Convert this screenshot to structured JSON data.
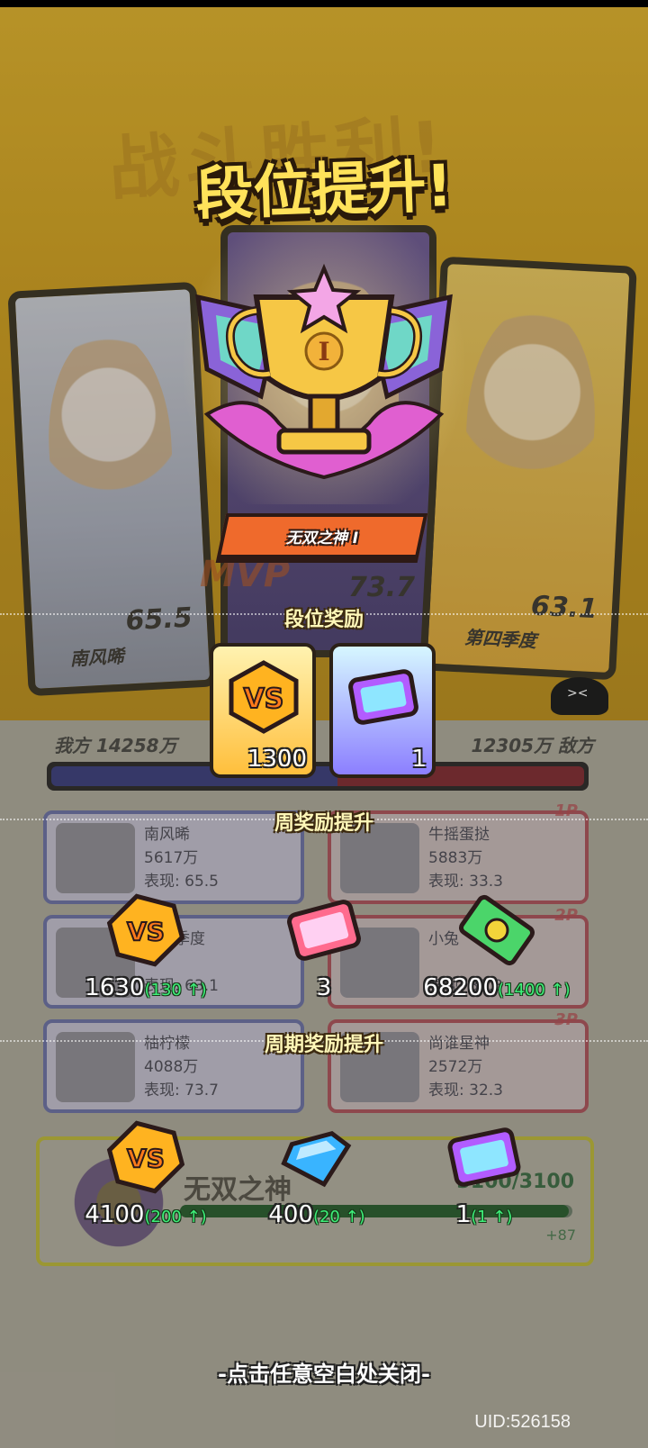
{
  "background": {
    "bg_title": "战斗胜利!",
    "heroes": [
      {
        "name": "南风晞",
        "score": "65.5"
      },
      {
        "name": "",
        "score": "73.7"
      },
      {
        "name": "第四季度",
        "score": "63.1"
      }
    ],
    "mvp_label": "MVP",
    "emoji": "><",
    "score_left": "我方  14258万",
    "score_right": "12305万  敌方",
    "team_ratio": 0.537,
    "players_left": [
      {
        "name": "南风晞",
        "power": "5617万",
        "perf": "表现: 65.5"
      },
      {
        "name": "第四季度",
        "power": "",
        "perf": "表现: 63.1"
      },
      {
        "name": "柚柠檬",
        "power": "4088万",
        "perf": "表现: 73.7"
      }
    ],
    "players_right": [
      {
        "name": "牛摇蛋挞",
        "power": "5883万",
        "perf": "表现: 33.3",
        "tag": "1P"
      },
      {
        "name": "小兔",
        "power": "",
        "perf": "表现: 37.3",
        "tag": "2P"
      },
      {
        "name": "尚谁星神",
        "power": "2572万",
        "perf": "表现: 32.3",
        "tag": "3P"
      }
    ],
    "rank_panel": {
      "title": "无双之神",
      "points": "3100/3100",
      "delta": "+87",
      "progress": 0.99
    }
  },
  "popup": {
    "title": "段位提升!",
    "rank_name": "无双之神 I",
    "trophy_numeral": "I",
    "rank_rewards_title": "段位奖励",
    "rank_rewards": [
      {
        "icon": "vs-coin-icon",
        "count": "1300"
      },
      {
        "icon": "ticket-icon",
        "count": "1"
      }
    ],
    "weekly_title": "周奖励提升",
    "weekly_rewards": [
      {
        "icon": "vs-coin-icon",
        "value": "1630",
        "inc": "(130 ↑)"
      },
      {
        "icon": "pink-ticket-icon",
        "value": "3",
        "inc": ""
      },
      {
        "icon": "cash-icon",
        "value": "68200",
        "inc": "(1400 ↑)"
      }
    ],
    "period_title": "周期奖励提升",
    "period_rewards": [
      {
        "icon": "vs-coin-icon",
        "value": "4100",
        "inc": "(200 ↑)"
      },
      {
        "icon": "diamond-icon",
        "value": "400",
        "inc": "(20 ↑)"
      },
      {
        "icon": "ticket-icon",
        "value": "1",
        "inc": "(1 ↑)"
      }
    ],
    "close_hint": "-点击任意空白处关闭-"
  },
  "footer": {
    "uid": "UID:526158"
  },
  "colors": {
    "accent_yellow": "#ffe25a",
    "increase_green": "#3ef07a",
    "banner_orange": "#ef6a2c"
  }
}
